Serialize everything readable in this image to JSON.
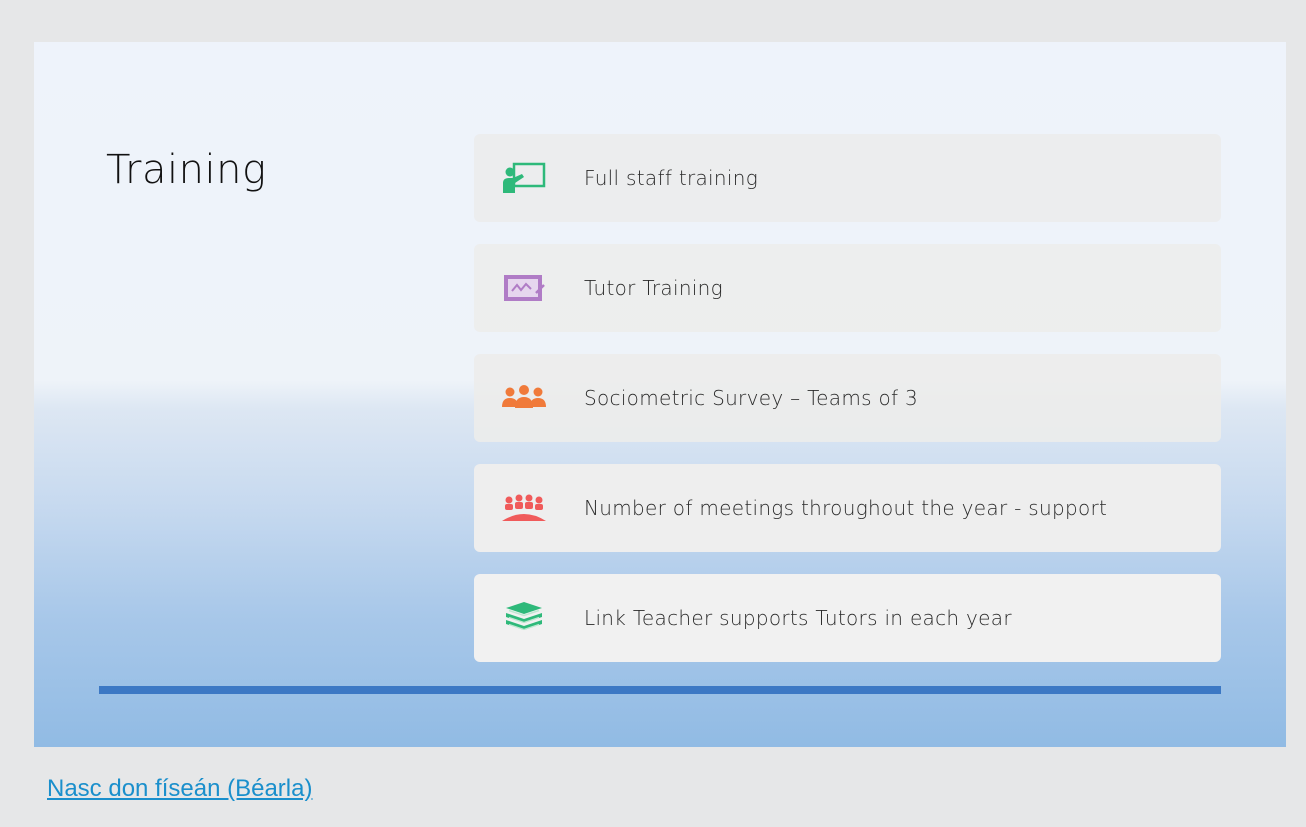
{
  "slide": {
    "title": "Training",
    "items": [
      {
        "label": "Full staff training",
        "icon": "teacher-board-icon",
        "icon_color": "#2eb97a"
      },
      {
        "label": "Tutor Training",
        "icon": "presentation-board-icon",
        "icon_color": "#b07cc6"
      },
      {
        "label": "Sociometric Survey – Teams of 3",
        "icon": "group-icon",
        "icon_color": "#f07a3a"
      },
      {
        "label": "Number of meetings throughout the year - support",
        "icon": "meeting-icon",
        "icon_color": "#f05a5a"
      },
      {
        "label": "Link Teacher supports Tutors in each year",
        "icon": "books-stack-icon",
        "icon_color": "#2eb97a"
      }
    ],
    "accent_color": "#3c78c4"
  },
  "footer": {
    "link_text": "Nasc don físeán (Béarla)",
    "link_color": "#1a8fcc"
  }
}
